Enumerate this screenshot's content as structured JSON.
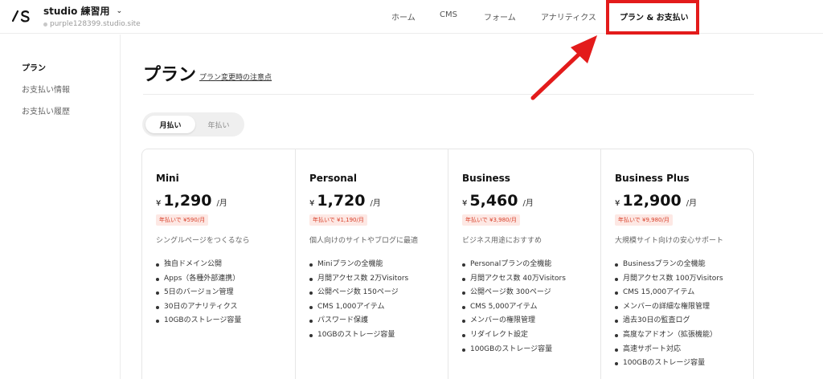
{
  "header": {
    "logo_text": "/S",
    "project_name": "studio 練習用",
    "project_url": "purple128399.studio.site",
    "nav": [
      {
        "label": "ホーム"
      },
      {
        "label": "CMS"
      },
      {
        "label": "フォーム"
      },
      {
        "label": "アナリティクス"
      },
      {
        "label": "プラン & お支払い"
      }
    ]
  },
  "sidebar": {
    "items": [
      {
        "label": "プラン"
      },
      {
        "label": "お支払い情報"
      },
      {
        "label": "お支払い履歴"
      }
    ]
  },
  "main": {
    "title": "プラン",
    "title_link": "プラン変更時の注意点",
    "toggle": {
      "monthly": "月払い",
      "yearly": "年払い"
    }
  },
  "plans": [
    {
      "name": "Mini",
      "currency": "¥",
      "price": "1,290",
      "per": "/月",
      "yearly_badge": "年払いで ¥590/月",
      "description": "シングルページをつくるなら",
      "features": [
        "独自ドメイン公開",
        "Apps（各種外部連携）",
        "5日のバージョン管理",
        "30日のアナリティクス",
        "10GBのストレージ容量"
      ]
    },
    {
      "name": "Personal",
      "currency": "¥",
      "price": "1,720",
      "per": "/月",
      "yearly_badge": "年払いで ¥1,190/月",
      "description": "個人向けのサイトやブログに最適",
      "features": [
        "Miniプランの全機能",
        "月間アクセス数 2万Visitors",
        "公開ページ数 150ページ",
        "CMS 1,000アイテム",
        "パスワード保護",
        "10GBのストレージ容量"
      ]
    },
    {
      "name": "Business",
      "currency": "¥",
      "price": "5,460",
      "per": "/月",
      "yearly_badge": "年払いで ¥3,980/月",
      "description": "ビジネス用途におすすめ",
      "features": [
        "Personalプランの全機能",
        "月間アクセス数 40万Visitors",
        "公開ページ数 300ページ",
        "CMS 5,000アイテム",
        "メンバーの権限管理",
        "リダイレクト設定",
        "100GBのストレージ容量"
      ]
    },
    {
      "name": "Business Plus",
      "currency": "¥",
      "price": "12,900",
      "per": "/月",
      "yearly_badge": "年払いで ¥9,980/月",
      "description": "大規模サイト向けの安心サポート",
      "features": [
        "Businessプランの全機能",
        "月間アクセス数 100万Visitors",
        "CMS 15,000アイテム",
        "メンバーの詳細な権限管理",
        "過去30日の監査ログ",
        "高度なアドオン（拡張機能）",
        "高速サポート対応",
        "100GBのストレージ容量"
      ]
    }
  ],
  "annotation": {
    "color": "#e31b1b"
  }
}
